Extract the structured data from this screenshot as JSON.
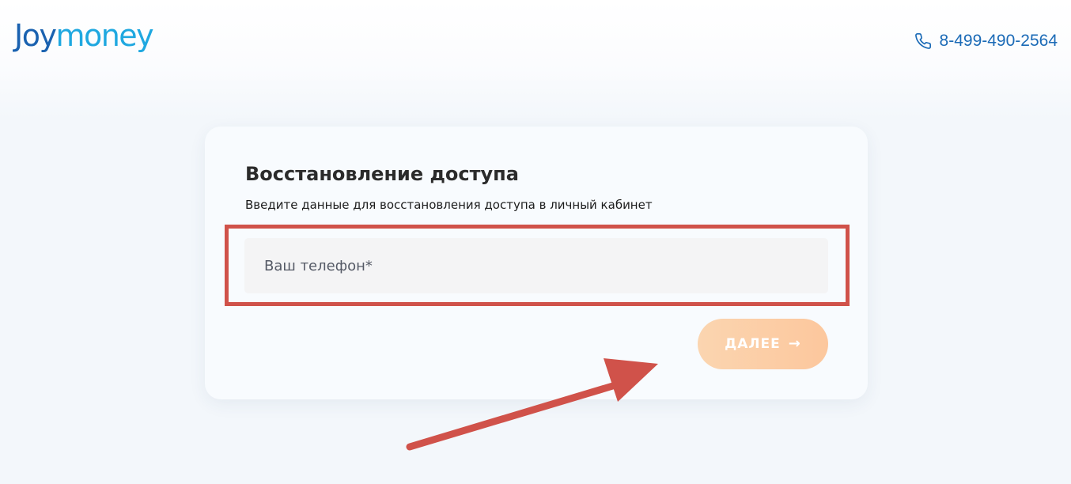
{
  "header": {
    "logo_part1": "Joy",
    "logo_part2": "money",
    "phone": "8-499-490-2564",
    "phone_icon": "phone-icon"
  },
  "form": {
    "title": "Восстановление доступа",
    "subtitle": "Введите данные для восстановления доступа в личный кабинет",
    "phone_placeholder": "Ваш телефон*",
    "phone_value": "",
    "next_label": "ДАЛЕЕ",
    "next_icon": "arrow-right-icon"
  },
  "colors": {
    "brand_dark": "#1a62b0",
    "brand_light": "#1fa8e0",
    "button": "#fcc79d",
    "annotation": "#d0524a"
  }
}
